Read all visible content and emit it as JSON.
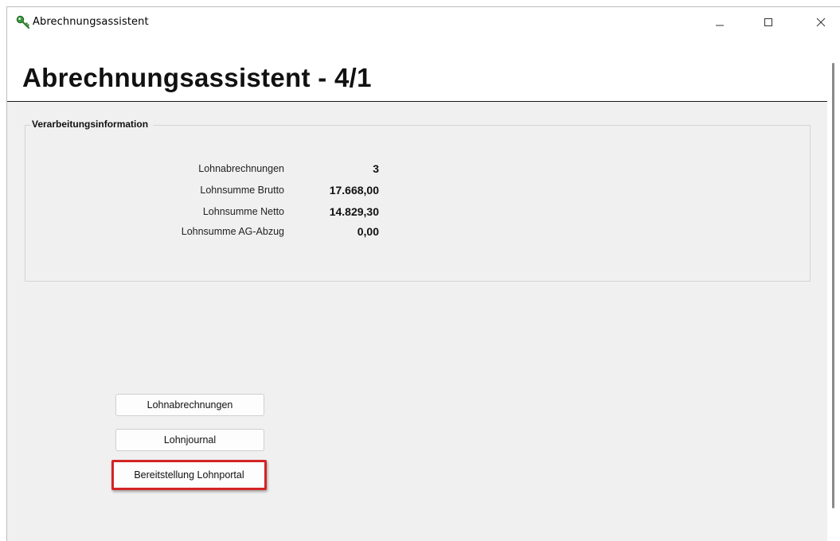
{
  "window": {
    "title": "Abrechnungsassistent",
    "controls": {
      "minimize": "—",
      "maximize": "☐",
      "close": "✕"
    }
  },
  "header": {
    "title": "Abrechnungsassistent - 4/1"
  },
  "info_group": {
    "legend": "Verarbeitungsinformation",
    "rows": [
      {
        "label": "Lohnabrechnungen",
        "value": "3"
      },
      {
        "label": "Lohnsumme Brutto",
        "value": "17.668,00"
      },
      {
        "label": "Lohnsumme Netto",
        "value": "14.829,30"
      },
      {
        "label": "Lohnsumme AG-Abzug",
        "value": "0,00"
      }
    ]
  },
  "buttons": {
    "lohnabrechnungen": "Lohnabrechnungen",
    "lohnjournal": "Lohnjournal",
    "bereitstellung": "Bereitstellung Lohnportal"
  },
  "colors": {
    "highlight": "#d32424",
    "body_background": "#f0f0f0"
  },
  "icons": {
    "app": "green-key-icon"
  }
}
